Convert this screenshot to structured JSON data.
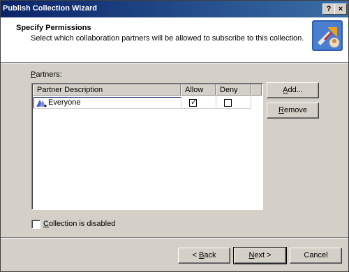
{
  "window": {
    "title": "Publish Collection Wizard",
    "help_button": "?",
    "close_button": "×"
  },
  "header": {
    "title": "Specify Permissions",
    "subtitle": "Select which collaboration partners will be allowed to subscribe to this collection.",
    "icon": "publish-wizard-icon"
  },
  "partners": {
    "label": "Partners:",
    "columns": [
      "Partner Description",
      "Allow",
      "Deny"
    ],
    "rows": [
      {
        "description": "Everyone",
        "icon": "users-icon",
        "allow": true,
        "deny": false
      }
    ]
  },
  "side_buttons": {
    "add": "Add...",
    "remove": "Remove"
  },
  "options": {
    "collection_disabled_label": "Collection is disabled",
    "collection_disabled_checked": false
  },
  "footer": {
    "back": "< Back",
    "next": "Next >",
    "cancel": "Cancel"
  },
  "colors": {
    "titlebar_start": "#0a246a",
    "titlebar_end": "#3a6ea5",
    "dialog_bg": "#d4d0c8"
  }
}
